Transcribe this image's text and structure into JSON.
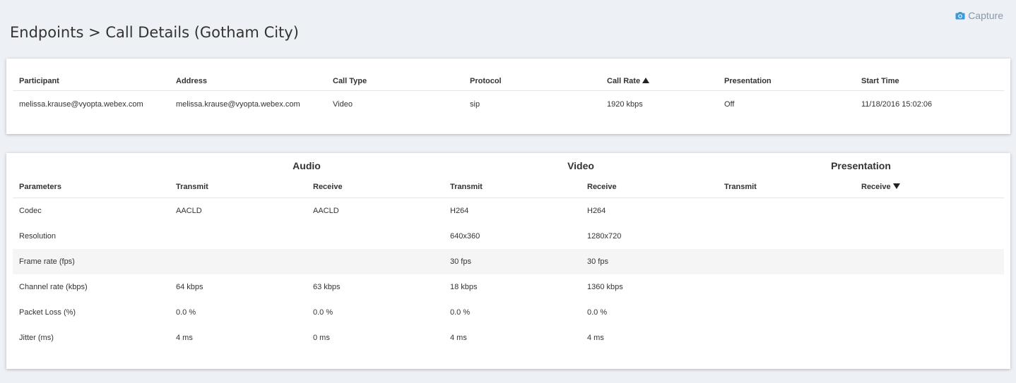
{
  "header": {
    "capture_label": "Capture",
    "page_title": "Endpoints > Call Details (Gotham City)"
  },
  "summary": {
    "columns": [
      "Participant",
      "Address",
      "Call Type",
      "Protocol",
      "Call Rate",
      "Presentation",
      "Start Time"
    ],
    "sorted_column": "Call Rate",
    "sort_direction": "ascending",
    "rows": [
      [
        "melissa.krause@vyopta.webex.com",
        "melissa.krause@vyopta.webex.com",
        "Video",
        "sip",
        "1920 kbps",
        "Off",
        "11/18/2016 15:02:06"
      ]
    ]
  },
  "details": {
    "groups": [
      "Audio",
      "Video",
      "Presentation"
    ],
    "columns": [
      "Parameters",
      "Transmit",
      "Receive",
      "Transmit",
      "Receive",
      "Transmit",
      "Receive"
    ],
    "sorted_column": "Receive (Presentation)",
    "sort_direction": "descending",
    "rows": [
      [
        "Codec",
        "AACLD",
        "AACLD",
        "H264",
        "H264",
        "",
        ""
      ],
      [
        "Resolution",
        "",
        "",
        "640x360",
        "1280x720",
        "",
        ""
      ],
      [
        "Frame rate (fps)",
        "",
        "",
        "30 fps",
        "30 fps",
        "",
        ""
      ],
      [
        "Channel rate (kbps)",
        "64 kbps",
        "63 kbps",
        "18 kbps",
        "1360 kbps",
        "",
        ""
      ],
      [
        "Packet Loss (%)",
        "0.0 %",
        "0.0 %",
        "0.0 %",
        "0.0 %",
        "",
        ""
      ],
      [
        "Jitter (ms)",
        "4 ms",
        "0 ms",
        "4 ms",
        "4 ms",
        "",
        ""
      ]
    ]
  },
  "colors": {
    "background": "#edf0f4",
    "card": "#ffffff",
    "capture_accent": "#3a9ad9",
    "striped_row": "#f5f5f5"
  },
  "icons": {
    "capture": "camera-icon",
    "sort_ascending": "sort-ascending-icon",
    "sort_descending": "sort-descending-icon"
  }
}
